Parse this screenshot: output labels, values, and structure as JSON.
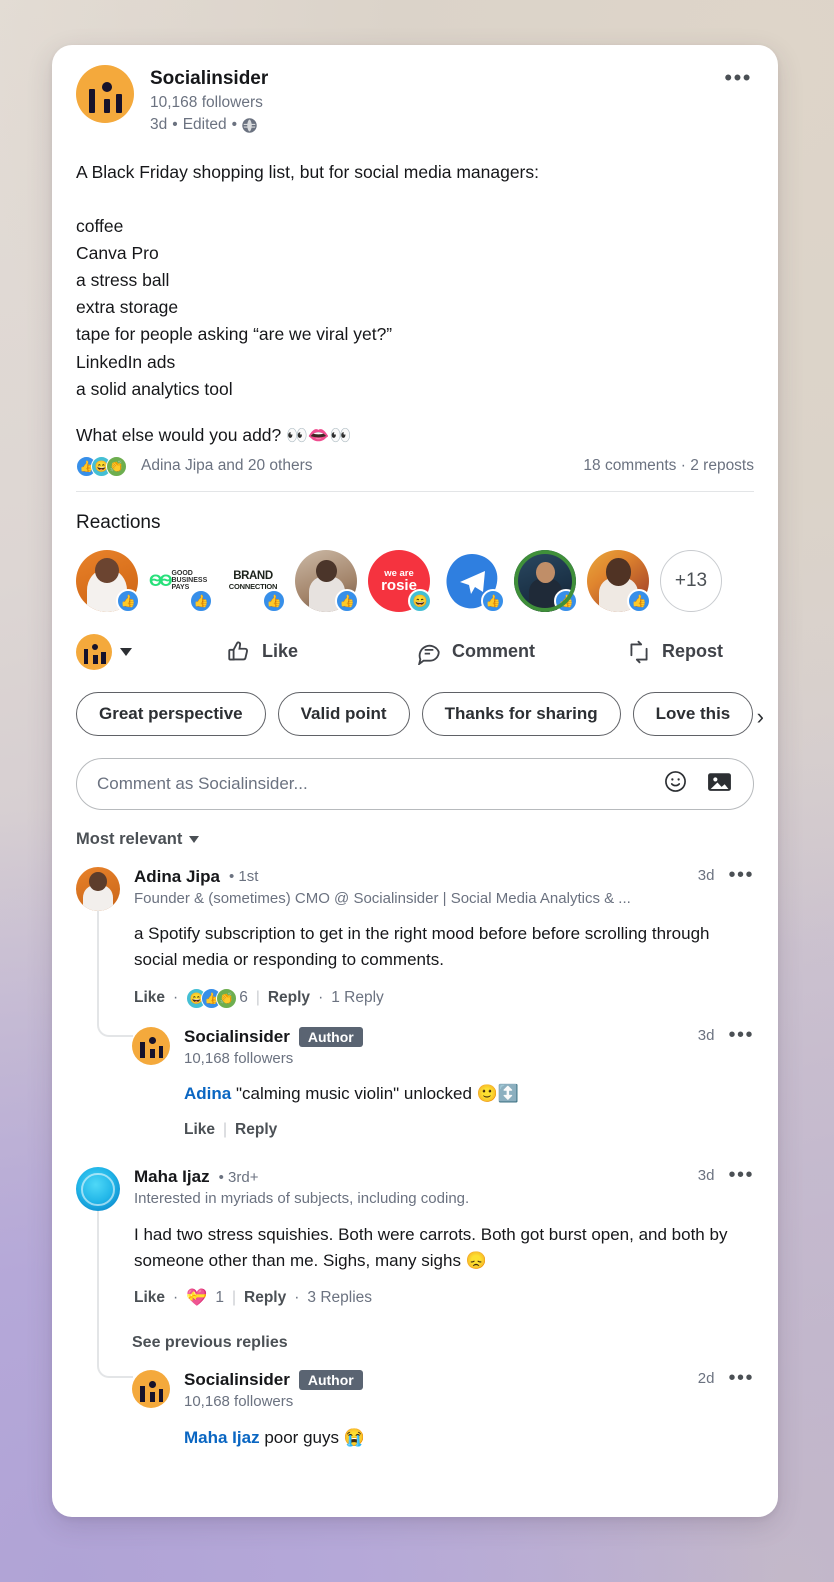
{
  "post": {
    "author": "Socialinsider",
    "followers": "10,168 followers",
    "time": "3d",
    "edited": "Edited",
    "separator": "•",
    "visibility_icon": "globe-icon",
    "more_icon": "ellipsis-icon",
    "body": "A Black Friday shopping list, but for social media managers:\n\ncoffee\nCanva Pro\na stress ball\nextra storage\ntape for people asking “are we viral yet?”\nLinkedIn ads\na solid analytics tool",
    "question": "What else would you add? 👀👄👀",
    "social_proof_names": "Adina Jipa and 20 others",
    "comments_count": "18 comments",
    "reposts_count": "2 reposts",
    "proof_separator": "·"
  },
  "reactions": {
    "title": "Reactions",
    "overflow_label": "+13",
    "items": [
      {
        "name": "woman-orange-avatar",
        "badge": "like",
        "kind": "photo-woman1",
        "label": ""
      },
      {
        "name": "good-business-pays-logo",
        "badge": "like",
        "kind": "logo-gbp",
        "label": "GOOD BUSINESS PAYS"
      },
      {
        "name": "brand-connection-logo",
        "badge": "like",
        "kind": "logo-brand",
        "label": "BRAND CONNECTION"
      },
      {
        "name": "woman-indoor-avatar",
        "badge": "like",
        "kind": "photo-woman2",
        "label": ""
      },
      {
        "name": "we-are-rosie-logo",
        "badge": "funny",
        "kind": "logo-rosie",
        "label": "we are rosie"
      },
      {
        "name": "paper-plane-logo",
        "badge": "like",
        "kind": "logo-plane",
        "label": ""
      },
      {
        "name": "man-suit-avatar",
        "badge": "like",
        "kind": "photo-man",
        "label": "#OPENTOWORK"
      },
      {
        "name": "woman-portrait-avatar",
        "badge": "like",
        "kind": "photo-woman3",
        "label": ""
      }
    ]
  },
  "actions": {
    "react_label": "",
    "like": "Like",
    "comment": "Comment",
    "repost": "Repost",
    "like_icon": "thumbs-up-icon",
    "comment_icon": "speech-bubble-icon",
    "repost_icon": "repost-arrows-icon",
    "caret_icon": "chevron-down-icon"
  },
  "chips": {
    "items": [
      "Great perspective",
      "Valid point",
      "Thanks for sharing",
      "Love this"
    ],
    "next_icon": "chevron-right-icon"
  },
  "comment_box": {
    "placeholder": "Comment as Socialinsider...",
    "emoji_icon": "smiley-icon",
    "image_icon": "image-icon"
  },
  "sort": {
    "label": "Most relevant",
    "caret_icon": "chevron-down-icon"
  },
  "comments": [
    {
      "avatar": "adina",
      "name": "Adina Jipa",
      "degree": "• 1st",
      "headline": "Founder & (sometimes) CMO @ Socialinsider | Social Media Analytics & ...",
      "time": "3d",
      "text": "a Spotify subscription to get in the right mood before before scrolling through social media or responding to comments.",
      "like": "Like",
      "reaction_count": "6",
      "reply": "Reply",
      "reply_count": "1 Reply",
      "dot": "·",
      "badge": "",
      "followers": ""
    },
    {
      "avatar": "socialinsider",
      "name": "Socialinsider",
      "badge": "Author",
      "followers": "10,168 followers",
      "time": "3d",
      "mention": "Adina",
      "text": " \"calming music violin\" unlocked 🙂↕️",
      "like": "Like",
      "reply": "Reply",
      "degree": "",
      "headline": "",
      "reaction_count": "",
      "reply_count": "",
      "dot": ""
    },
    {
      "avatar": "maha",
      "name": "Maha Ijaz",
      "degree": "• 3rd+",
      "headline": "Interested in myriads of subjects, including coding.",
      "time": "3d",
      "text": "I had two stress squishies. Both were carrots. Both got burst open, and both by someone other than me. Sighs, many sighs 😞",
      "like": "Like",
      "reaction_count": "1",
      "reply": "Reply",
      "reply_count": "3 Replies",
      "dot": "·",
      "badge": "",
      "followers": ""
    },
    {
      "avatar": "socialinsider",
      "name": "Socialinsider",
      "badge": "Author",
      "followers": "10,168 followers",
      "time": "2d",
      "mention": "Maha Ijaz",
      "text": " poor guys 😭",
      "like": "",
      "reply": "",
      "degree": "",
      "headline": "",
      "reaction_count": "",
      "reply_count": "",
      "dot": ""
    }
  ],
  "see_previous_replies": "See previous replies",
  "colors": {
    "brand_orange": "#f4a93c",
    "link_blue": "#0a66c2",
    "like_blue": "#378fe9",
    "author_badge": "#5a6472",
    "text_primary": "#16171a",
    "text_secondary": "#6b7280"
  }
}
